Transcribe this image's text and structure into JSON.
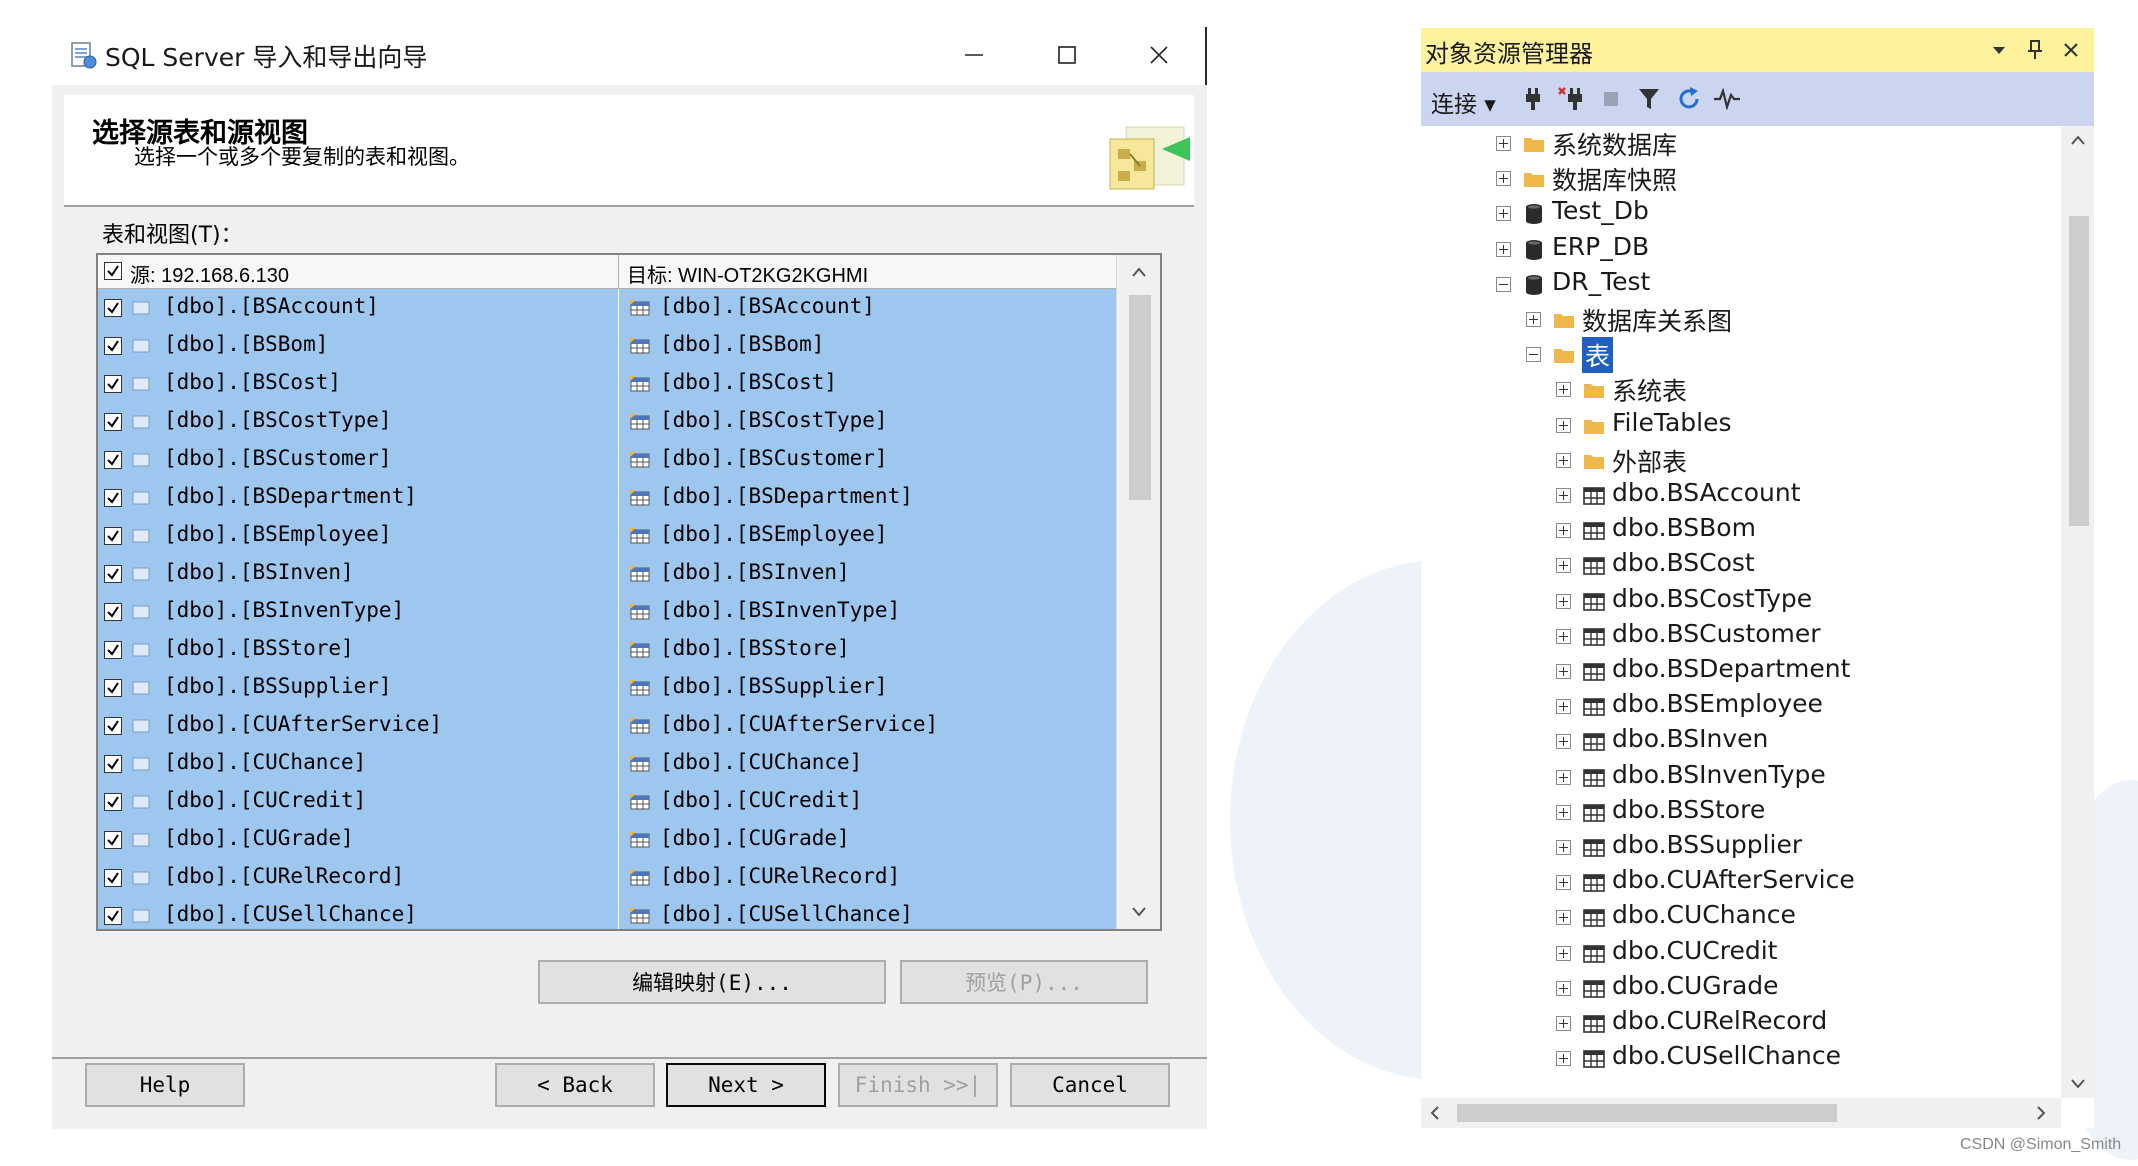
{
  "wizard": {
    "title": "SQL Server 导入和导出向导",
    "header_title": "选择源表和源视图",
    "header_subtitle": "选择一个或多个要复制的表和视图。",
    "tables_label": "表和视图(T)：",
    "grid": {
      "source_header": "源: 192.168.6.130",
      "destination_header": "目标: WIN-OT2KG2KGHMI",
      "rows": [
        {
          "source": "[dbo].[BSAccount]",
          "destination": "[dbo].[BSAccount]"
        },
        {
          "source": "[dbo].[BSBom]",
          "destination": "[dbo].[BSBom]"
        },
        {
          "source": "[dbo].[BSCost]",
          "destination": "[dbo].[BSCost]"
        },
        {
          "source": "[dbo].[BSCostType]",
          "destination": "[dbo].[BSCostType]"
        },
        {
          "source": "[dbo].[BSCustomer]",
          "destination": "[dbo].[BSCustomer]"
        },
        {
          "source": "[dbo].[BSDepartment]",
          "destination": "[dbo].[BSDepartment]"
        },
        {
          "source": "[dbo].[BSEmployee]",
          "destination": "[dbo].[BSEmployee]"
        },
        {
          "source": "[dbo].[BSInven]",
          "destination": "[dbo].[BSInven]"
        },
        {
          "source": "[dbo].[BSInvenType]",
          "destination": "[dbo].[BSInvenType]"
        },
        {
          "source": "[dbo].[BSStore]",
          "destination": "[dbo].[BSStore]"
        },
        {
          "source": "[dbo].[BSSupplier]",
          "destination": "[dbo].[BSSupplier]"
        },
        {
          "source": "[dbo].[CUAfterService]",
          "destination": "[dbo].[CUAfterService]"
        },
        {
          "source": "[dbo].[CUChance]",
          "destination": "[dbo].[CUChance]"
        },
        {
          "source": "[dbo].[CUCredit]",
          "destination": "[dbo].[CUCredit]"
        },
        {
          "source": "[dbo].[CUGrade]",
          "destination": "[dbo].[CUGrade]"
        },
        {
          "source": "[dbo].[CURelRecord]",
          "destination": "[dbo].[CURelRecord]"
        },
        {
          "source": "[dbo].[CUSellChance]",
          "destination": "[dbo].[CUSellChance]"
        }
      ]
    },
    "buttons": {
      "edit_mappings": "编辑映射(E)...",
      "preview": "预览(P)...",
      "help": "Help",
      "back": "< Back",
      "next": "Next >",
      "finish": "Finish >>|",
      "cancel": "Cancel"
    }
  },
  "explorer": {
    "title": "对象资源管理器",
    "connect_label": "连接",
    "tree": [
      {
        "label": "系统数据库",
        "level": 0,
        "icon": "folder-icon",
        "expanded": false
      },
      {
        "label": "数据库快照",
        "level": 0,
        "icon": "folder-icon",
        "expanded": false
      },
      {
        "label": "Test_Db",
        "level": 0,
        "icon": "database-icon",
        "expanded": false
      },
      {
        "label": "ERP_DB",
        "level": 0,
        "icon": "database-icon",
        "expanded": false
      },
      {
        "label": "DR_Test",
        "level": 0,
        "icon": "database-icon",
        "expanded": true
      },
      {
        "label": "数据库关系图",
        "level": 1,
        "icon": "folder-icon",
        "expanded": false
      },
      {
        "label": "表",
        "level": 1,
        "icon": "folder-icon",
        "expanded": true,
        "selected": true
      },
      {
        "label": "系统表",
        "level": 2,
        "icon": "folder-icon",
        "expanded": false
      },
      {
        "label": "FileTables",
        "level": 2,
        "icon": "folder-icon",
        "expanded": false
      },
      {
        "label": "外部表",
        "level": 2,
        "icon": "folder-icon",
        "expanded": false
      },
      {
        "label": "dbo.BSAccount",
        "level": 2,
        "icon": "table-icon",
        "expanded": false
      },
      {
        "label": "dbo.BSBom",
        "level": 2,
        "icon": "table-icon",
        "expanded": false
      },
      {
        "label": "dbo.BSCost",
        "level": 2,
        "icon": "table-icon",
        "expanded": false
      },
      {
        "label": "dbo.BSCostType",
        "level": 2,
        "icon": "table-icon",
        "expanded": false
      },
      {
        "label": "dbo.BSCustomer",
        "level": 2,
        "icon": "table-icon",
        "expanded": false
      },
      {
        "label": "dbo.BSDepartment",
        "level": 2,
        "icon": "table-icon",
        "expanded": false
      },
      {
        "label": "dbo.BSEmployee",
        "level": 2,
        "icon": "table-icon",
        "expanded": false
      },
      {
        "label": "dbo.BSInven",
        "level": 2,
        "icon": "table-icon",
        "expanded": false
      },
      {
        "label": "dbo.BSInvenType",
        "level": 2,
        "icon": "table-icon",
        "expanded": false
      },
      {
        "label": "dbo.BSStore",
        "level": 2,
        "icon": "table-icon",
        "expanded": false
      },
      {
        "label": "dbo.BSSupplier",
        "level": 2,
        "icon": "table-icon",
        "expanded": false
      },
      {
        "label": "dbo.CUAfterService",
        "level": 2,
        "icon": "table-icon",
        "expanded": false
      },
      {
        "label": "dbo.CUChance",
        "level": 2,
        "icon": "table-icon",
        "expanded": false
      },
      {
        "label": "dbo.CUCredit",
        "level": 2,
        "icon": "table-icon",
        "expanded": false
      },
      {
        "label": "dbo.CUGrade",
        "level": 2,
        "icon": "table-icon",
        "expanded": false
      },
      {
        "label": "dbo.CURelRecord",
        "level": 2,
        "icon": "table-icon",
        "expanded": false
      },
      {
        "label": "dbo.CUSellChance",
        "level": 2,
        "icon": "table-icon",
        "expanded": false
      }
    ]
  },
  "watermark": "CSDN @Simon_Smith",
  "colors": {
    "row_selected": "#9dc7ee",
    "explorer_title_bg": "#fff29d",
    "explorer_toolbar_bg": "#ccd5f0",
    "tree_selected": "#1f5fbf",
    "folder": "#f0b74a"
  }
}
